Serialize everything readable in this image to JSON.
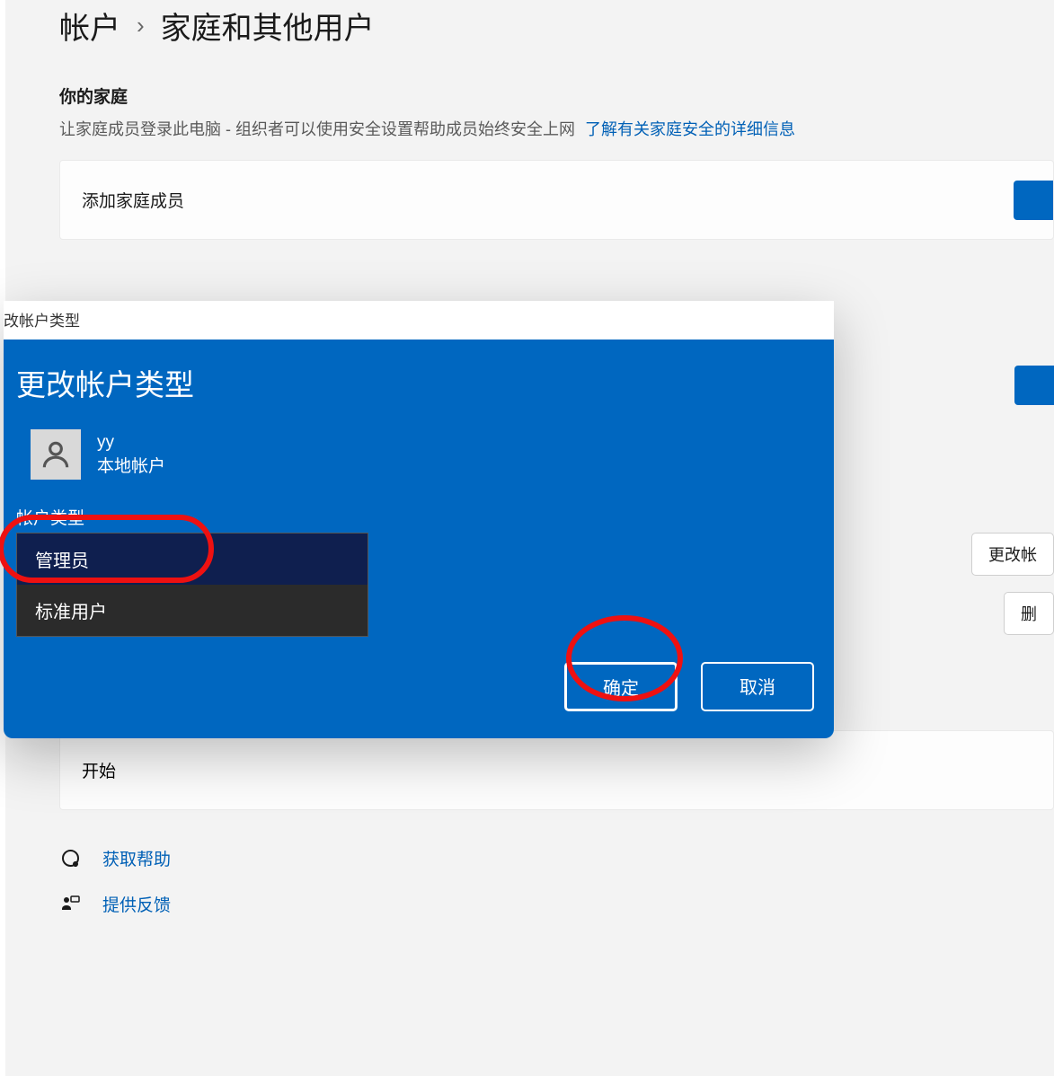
{
  "breadcrumb": {
    "parent": "帐户",
    "current": "家庭和其他用户"
  },
  "family": {
    "title": "你的家庭",
    "desc": "让家庭成员登录此电脑 - 组织者可以使用安全设置帮助成员始终安全上网",
    "link": "了解有关家庭安全的详细信息",
    "add_label": "添加家庭成员"
  },
  "dialog": {
    "titlebar": "改帐户类型",
    "heading": "更改帐户类型",
    "user": {
      "name": "yy",
      "sub": "本地帐户"
    },
    "type_label": "帐户类型",
    "options": {
      "admin": "管理员",
      "standard": "标准用户"
    },
    "ok": "确定",
    "cancel": "取消"
  },
  "side": {
    "change": "更改帐",
    "remove": "删"
  },
  "kiosk": {
    "start": "开始"
  },
  "footer": {
    "help": "获取帮助",
    "feedback": "提供反馈"
  }
}
